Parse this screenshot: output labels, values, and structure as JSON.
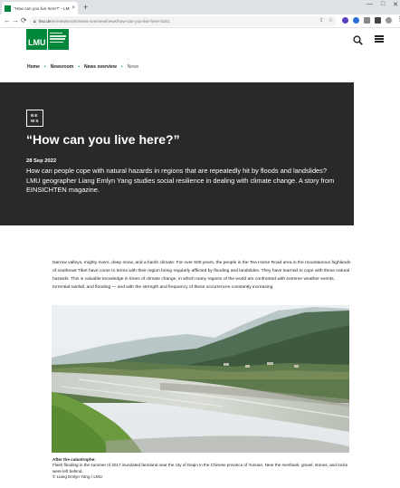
{
  "browser": {
    "tab_title": "\"How can you live here?\" - LMU",
    "tab_close": "×",
    "new_tab": "+",
    "window_controls": [
      "—",
      "□",
      "✕"
    ],
    "back": "←",
    "forward": "→",
    "reload": "⟳",
    "url_host": "lmu.de",
    "url_path": "/en/newsroom/news-overview/news/how-can-you-live-here-3151"
  },
  "site": {
    "logo_text": "LMU",
    "logo_subtitle_lines": [
      "LUDWIG-",
      "MAXIMILIANS-",
      "UNIVERSITÄT",
      "MÜNCHEN"
    ]
  },
  "breadcrumb": [
    "Home",
    "Newsroom",
    "News overview",
    "News"
  ],
  "article": {
    "badge": "NE WS",
    "badge_line1": "NE",
    "badge_line2": "WS",
    "title": "“How can you live here?”",
    "date": "28 Sep 2022",
    "lead": "How can people cope with natural hazards in regions that are repeatedly hit by floods and landslides? LMU geographer Liang Emlyn Yang studies social resilience in dealing with climate change. A story from EINSICHTEN magazine.",
    "body": "Narrow valleys, mighty rivers, deep snow, and a harsh climate: For over 600 years, the people in the Tea Horse Road area in the mountainous highlands of southeast Tibet have come to terms with their region being regularly afflicted by flooding and landslides. They have learned to cope with these natural hazards. This is valuable knowledge in times of climate change, in which many regions of the world are confronted with extreme weather events, torrential rainfall, and flooding — and with the strength and frequency of these occurrences constantly increasing.",
    "caption_title": "After the catastrophe:",
    "caption_text": "Flash flooding in the summer of 2017 inundated farmland near the city of Deqin in the Chinese province of Yunnan. Near the riverbank, gravel, stones, and rocks were left behind.",
    "credit": "© Liang Emlyn Yang / LMU"
  },
  "colors": {
    "brand": "#00883a",
    "hero_bg": "#292929"
  }
}
